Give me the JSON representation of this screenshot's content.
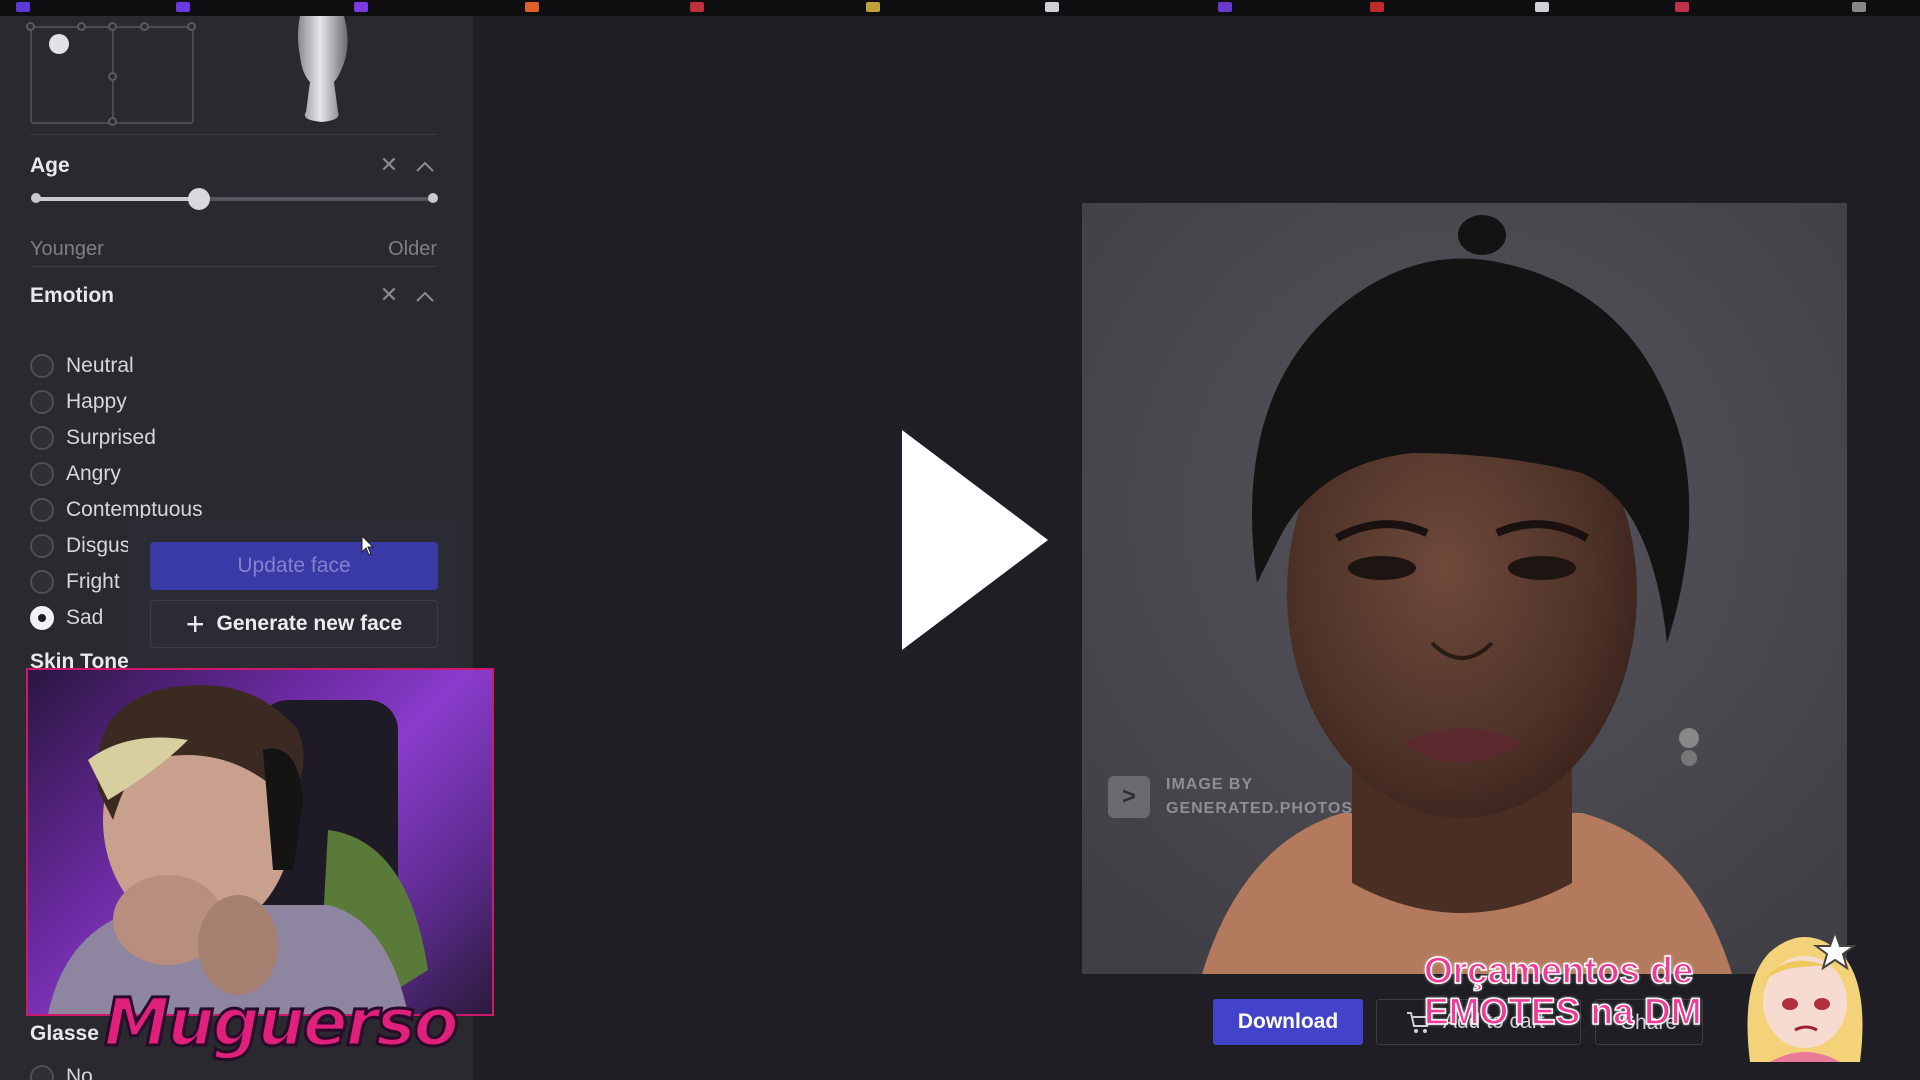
{
  "age": {
    "title": "Age",
    "value_fraction": 0.41,
    "min_label": "Younger",
    "max_label": "Older"
  },
  "emotion": {
    "title": "Emotion",
    "options": [
      {
        "label": "Neutral",
        "checked": false
      },
      {
        "label": "Happy",
        "checked": false
      },
      {
        "label": "Surprised",
        "checked": false
      },
      {
        "label": "Angry",
        "checked": false
      },
      {
        "label": "Contemptuous",
        "checked": false
      },
      {
        "label": "Disgusted",
        "visible_label": "Disgus",
        "checked": false
      },
      {
        "label": "Frightened",
        "visible_label": "Fright",
        "checked": false
      },
      {
        "label": "Sad",
        "checked": true
      }
    ]
  },
  "sections_below": {
    "skin_tone": "Skin Tone",
    "glasses": "Glasse",
    "glasses_first_option": "No"
  },
  "popover": {
    "update_label": "Update face",
    "generate_label": "Generate new face"
  },
  "watermark": {
    "line1": "IMAGE BY",
    "line2": "GENERATED.PHOTOS"
  },
  "actions": {
    "download_label": "Download",
    "cart_label": "Add to cart",
    "share_label": "Share"
  },
  "overlay": {
    "streamer_logo": "Muguerso",
    "promo_line1": "Orçamentos de",
    "promo_line2": "EMOTES na DM"
  },
  "colors": {
    "accent": "#4343c9",
    "sidebar_bg": "#29292f",
    "main_bg": "#1e1e24",
    "webcam_border": "#d0186a",
    "promo_pink": "#f03a96"
  },
  "icons": [
    "close-icon",
    "chevron-up-icon",
    "plus-icon",
    "cart-icon",
    "play-icon",
    "generated-photos-logo-icon",
    "cursor-icon"
  ]
}
